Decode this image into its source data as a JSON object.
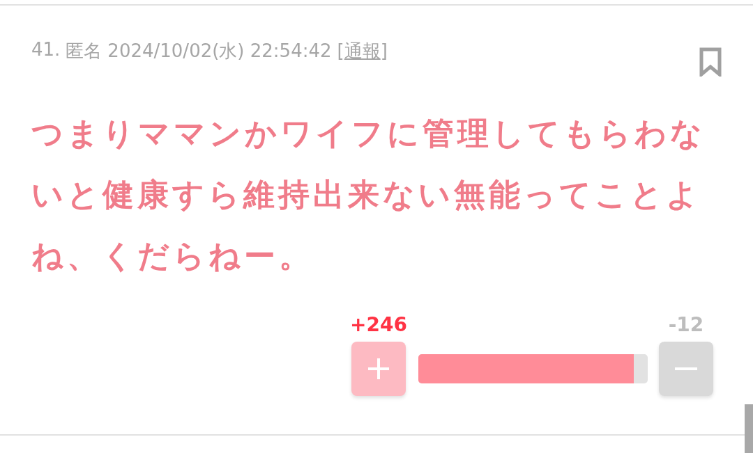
{
  "comment": {
    "number": "41.",
    "author": "匿名",
    "datetime": "2024/10/02(水) 22:54:42",
    "report_link": {
      "open": "[",
      "label": "通報",
      "close": "]"
    },
    "body": "つまりママンかワイフに管理してもらわないと健康すら維持出来ない無能ってことよね、くだらねー。",
    "votes": {
      "up_count": "+246",
      "down_count": "-12",
      "level": 0.94
    }
  }
}
